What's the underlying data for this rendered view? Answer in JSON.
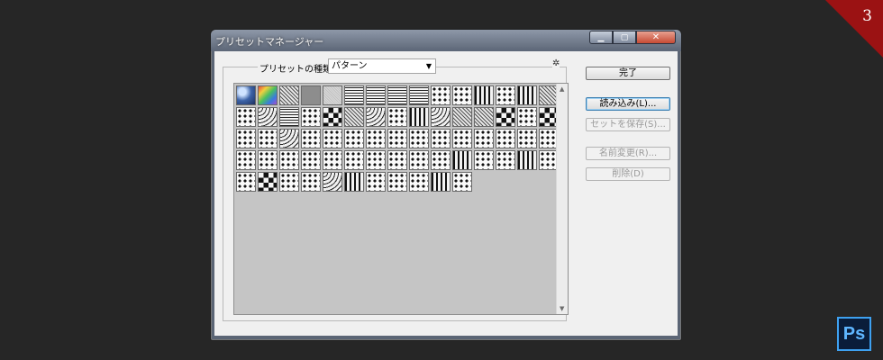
{
  "page": {
    "number": "3",
    "app_logo": "Ps"
  },
  "dialog": {
    "title": "プリセットマネージャー",
    "window_buttons": {
      "minimize": "▁",
      "maximize": "▢",
      "close": "✕"
    },
    "preset_type_label": "プリセットの種類(P)：",
    "preset_type_value": "パターン",
    "buttons": {
      "done": "完了",
      "load": "読み込み(L)...",
      "save_set": "セットを保存(S)...",
      "rename": "名前変更(R)...",
      "delete": "削除(D)"
    }
  },
  "patterns": [
    "bubbles",
    "rainbow",
    "mesh",
    "gray",
    "noise",
    "grid",
    "grid",
    "grid",
    "grid",
    "dots",
    "dots",
    "stripes",
    "dots",
    "stripes",
    "mesh",
    "dots",
    "waves",
    "grid",
    "dots",
    "checker",
    "mesh",
    "waves",
    "dots",
    "stripes",
    "waves",
    "mesh",
    "mesh",
    "checker",
    "dots",
    "checker",
    "dots",
    "dots",
    "waves",
    "dots",
    "dots",
    "dots",
    "dots",
    "dots",
    "dots",
    "dots",
    "dots",
    "dots",
    "dots",
    "dots",
    "dots",
    "dots",
    "dots",
    "dots",
    "dots",
    "dots",
    "dots",
    "dots",
    "dots",
    "dots",
    "dots",
    "stripes",
    "dots",
    "dots",
    "stripes",
    "dots",
    "dots",
    "checker",
    "dots",
    "dots",
    "waves",
    "stripes",
    "dots",
    "dots",
    "dots",
    "stripes",
    "dots"
  ]
}
